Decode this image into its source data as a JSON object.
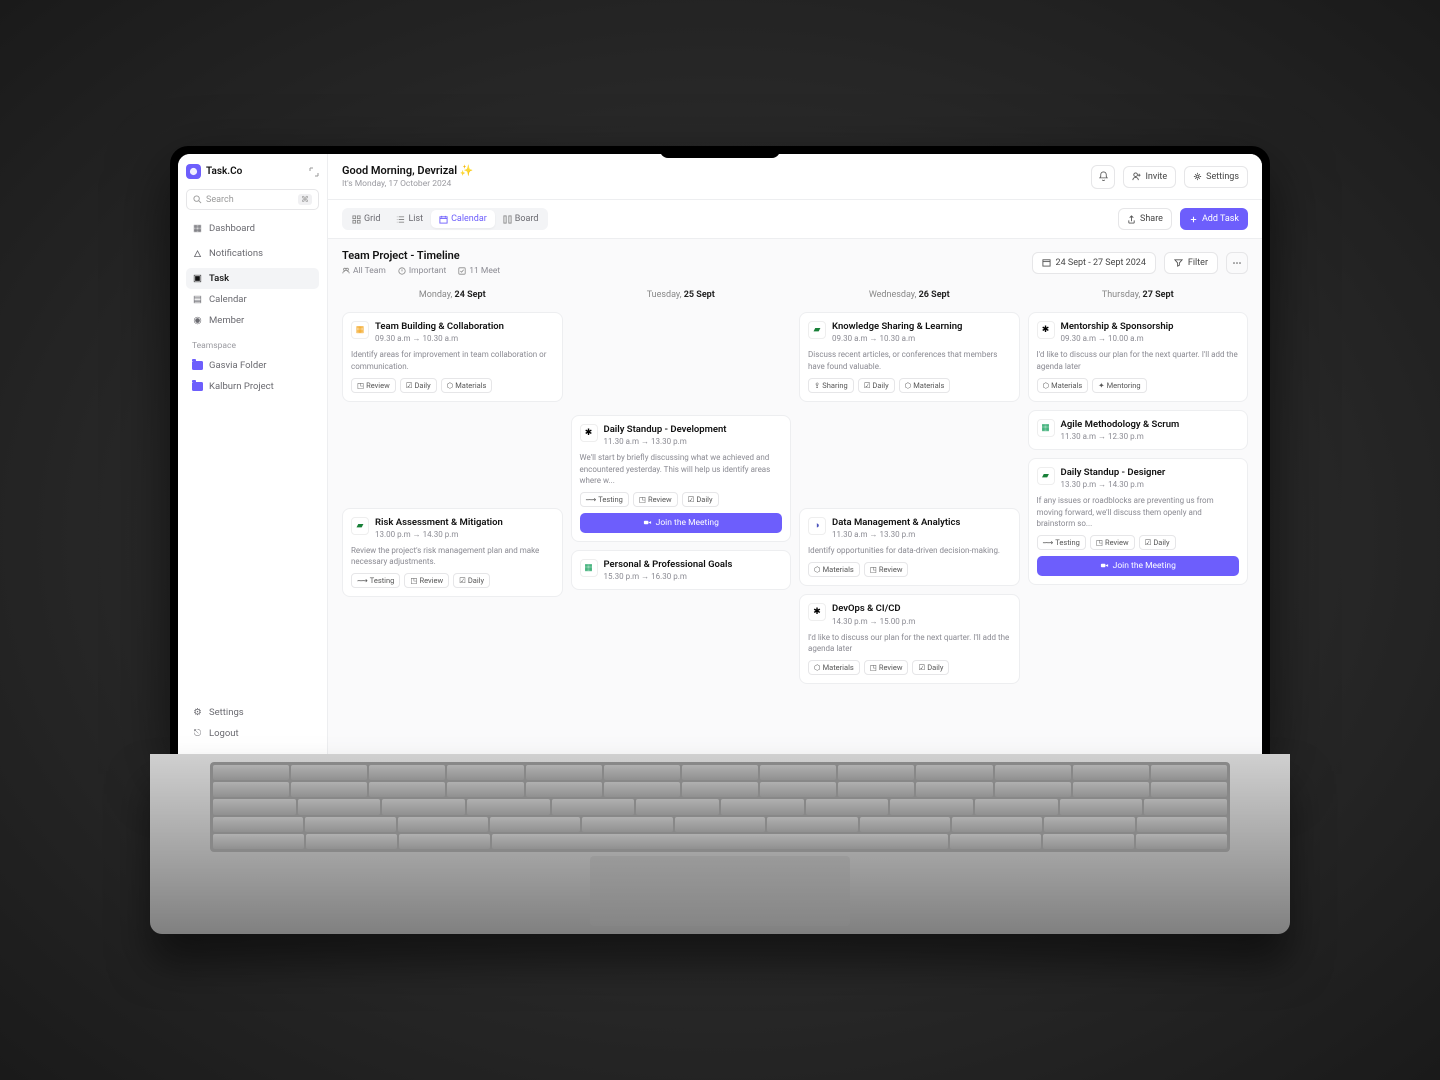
{
  "brand": {
    "name": "Task.Co"
  },
  "search": {
    "placeholder": "Search",
    "shortcut": "⌘"
  },
  "nav": {
    "dashboard": "Dashboard",
    "notifications": "Notifications",
    "task": "Task",
    "calendar": "Calendar",
    "member": "Member"
  },
  "teamspace": {
    "label": "Teamspace",
    "folder1": "Gasvia Folder",
    "folder2": "Kalburn Project"
  },
  "sidebar_bottom": {
    "settings": "Settings",
    "logout": "Logout"
  },
  "topbar": {
    "greeting": "Good Morning, Devrizal ✨",
    "date": "It's Monday, 17 October 2024",
    "invite": "Invite",
    "settings": "Settings"
  },
  "viewbar": {
    "grid": "Grid",
    "list": "List",
    "calendar": "Calendar",
    "board": "Board",
    "share": "Share",
    "add_task": "Add Task"
  },
  "project": {
    "title": "Team Project - Timeline",
    "all_team": "All Team",
    "important": "Important",
    "meet_count": "11 Meet",
    "date_range": "24 Sept - 27 Sept 2024",
    "filter": "Filter"
  },
  "days": {
    "mon_pre": "Monday, ",
    "mon_b": "24 Sept",
    "tue_pre": "Tuesday, ",
    "tue_b": "25 Sept",
    "wed_pre": "Wednesday, ",
    "wed_b": "26 Sept",
    "thu_pre": "Thursday, ",
    "thu_b": "27 Sept"
  },
  "tags": {
    "review": "Review",
    "daily": "Daily",
    "materials": "Materials",
    "testing": "Testing",
    "sharing": "Sharing",
    "mentoring": "Mentoring"
  },
  "join": "Join the Meeting",
  "cards": {
    "mon1": {
      "title": "Team Building & Collaboration",
      "time": "09.30 a.m → 10.30 a.m",
      "desc": "Identify areas for improvement in team collaboration or communication."
    },
    "mon2": {
      "title": "Risk Assessment & Mitigation",
      "time": "13.00 p.m → 14.30 p.m",
      "desc": "Review the project's risk management plan and make necessary adjustments."
    },
    "tue1": {
      "title": "Daily Standup - Development",
      "time": "11.30 a.m → 13.30 p.m",
      "desc": "We'll start by briefly discussing what we achieved and encountered yesterday. This will help us identify areas where w..."
    },
    "tue2": {
      "title": "Personal & Professional Goals",
      "time": "15.30 p.m → 16.30 p.m"
    },
    "wed1": {
      "title": "Knowledge Sharing & Learning",
      "time": "09.30 a.m → 10.30 a.m",
      "desc": "Discuss recent articles, or conferences that members have found valuable."
    },
    "wed2": {
      "title": "Data Management & Analytics",
      "time": "11.30 a.m → 13.30 p.m",
      "desc": "Identify opportunities for data-driven decision-making."
    },
    "wed3": {
      "title": "DevOps & CI/CD",
      "time": "14.30 p.m → 15.00 p.m",
      "desc": "I'd like to discuss our plan for the next quarter. I'll add the agenda later"
    },
    "thu1": {
      "title": "Mentorship & Sponsorship",
      "time": "09.30 a.m → 10.00 a.m",
      "desc": "I'd like to discuss our plan for the next quarter. I'll add the agenda later"
    },
    "thu2": {
      "title": "Agile Methodology & Scrum",
      "time": "11.30 a.m → 12.30 p.m"
    },
    "thu3": {
      "title": "Daily Standup - Designer",
      "time": "13.30 p.m → 14.30 p.m",
      "desc": "If any issues or roadblocks are preventing us from moving forward, we'll discuss them openly and brainstorm so..."
    }
  }
}
